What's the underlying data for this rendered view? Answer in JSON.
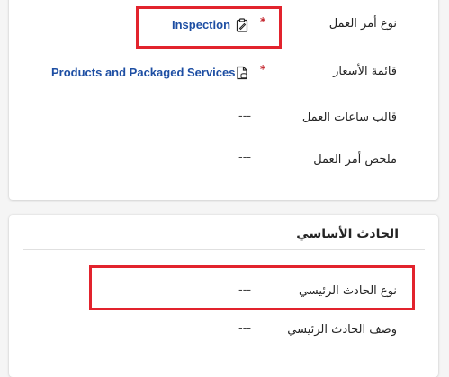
{
  "work_order": {
    "type": {
      "label": "نوع أمر العمل",
      "value": "Inspection",
      "icon": "clipboard-icon",
      "required": "*"
    },
    "price_list": {
      "label": "قائمة الأسعار",
      "value": "Products and Packaged Services",
      "icon": "price-list-icon",
      "required": "*"
    },
    "calendar_template": {
      "label": "قالب ساعات العمل",
      "value": "---"
    },
    "summary": {
      "label": "ملخص أمر العمل",
      "value": "---"
    }
  },
  "primary_incident": {
    "section_title": "الحادث الأساسي",
    "type": {
      "label": "نوع الحادث الرئيسي",
      "value": "---"
    },
    "description": {
      "label": "وصف الحادث الرئيسي",
      "value": "---"
    }
  },
  "colors": {
    "link": "#1d4ea3",
    "required": "#c4262e",
    "highlight": "#e2232d"
  }
}
